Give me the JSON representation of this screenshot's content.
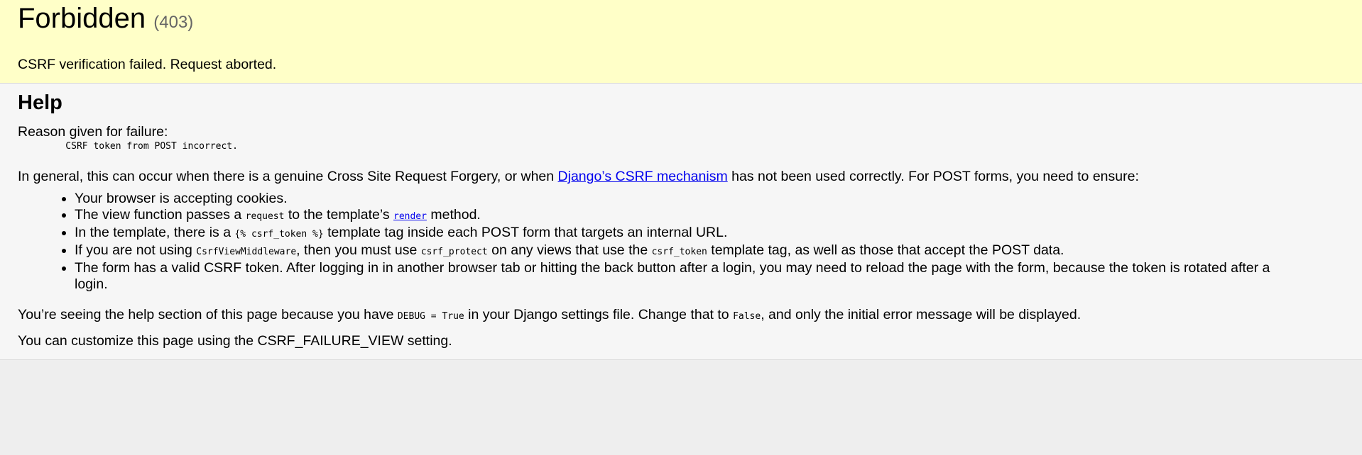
{
  "summary": {
    "title": "Forbidden",
    "code": "(403)",
    "message": "CSRF verification failed. Request aborted."
  },
  "help": {
    "heading": "Help",
    "reason_label": "Reason given for failure:",
    "reason": "    CSRF token from POST incorrect.",
    "general_before": "In general, this can occur when there is a genuine Cross Site Request Forgery, or when ",
    "general_link": "Django’s CSRF mechanism",
    "general_after": " has not been used correctly. For POST forms, you need to ensure:",
    "items": {
      "cookies": "Your browser is accepting cookies.",
      "view_before": "The view function passes a ",
      "view_code": "request",
      "view_mid": " to the template’s ",
      "view_link": "render",
      "view_after": " method.",
      "tag_before": "In the template, there is a ",
      "tag_code": "{% csrf_token %}",
      "tag_after": " template tag inside each POST form that targets an internal URL.",
      "mw_before": "If you are not using ",
      "mw_code1": "CsrfViewMiddleware",
      "mw_mid1": ", then you must use ",
      "mw_code2": "csrf_protect",
      "mw_mid2": " on any views that use the ",
      "mw_code3": "csrf_token",
      "mw_after": " template tag, as well as those that accept the POST data.",
      "token": "The form has a valid CSRF token. After logging in in another browser tab or hitting the back button after a login, you may need to reload the page with the form, because the token is rotated after a login."
    },
    "debug_before": "You’re seeing the help section of this page because you have ",
    "debug_code1": "DEBUG = True",
    "debug_mid": " in your Django settings file. Change that to ",
    "debug_code2": "False",
    "debug_after": ", and only the initial error message will be displayed.",
    "customize": "You can customize this page using the CSRF_FAILURE_VIEW setting."
  }
}
